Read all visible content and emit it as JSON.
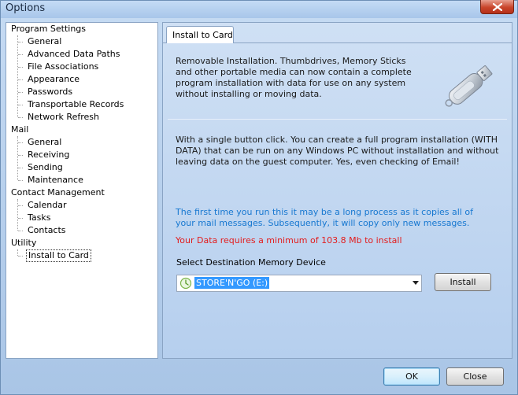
{
  "window": {
    "title": "Options"
  },
  "nav": {
    "categories": [
      {
        "label": "Program Settings",
        "items": [
          "General",
          "Advanced Data Paths",
          "File Associations",
          "Appearance",
          "Passwords",
          "Transportable Records",
          "Network Refresh"
        ]
      },
      {
        "label": "Mail",
        "items": [
          "General",
          "Receiving",
          "Sending",
          "Maintenance"
        ]
      },
      {
        "label": "Contact Management",
        "items": [
          "Calendar",
          "Tasks",
          "Contacts"
        ]
      },
      {
        "label": "Utility",
        "items": [
          "Install to Card"
        ]
      }
    ],
    "selected": "Install to Card"
  },
  "content": {
    "tab_label": "Install to Card",
    "intro": "Removable Installation.  Thumbdrives, Memory Sticks and other portable media can now contain a complete program installation with data for use on any system without installing or moving data.",
    "description": "With a single button click.  You can create a full program installation (WITH DATA) that can be run on any Windows PC without installation and without leaving data on the guest computer.  Yes, even checking of Email!",
    "first_time_note": "The first time you run this it may be a long process as it copies all of your mail messages.  Subsequently, it will copy only new messages.",
    "requirement_warning": "Your Data requires a minimum of 103.8 Mb to install",
    "select_label": "Select Destination Memory Device",
    "selected_device": "STORE'N'GO (E:)",
    "install_label": "Install"
  },
  "footer": {
    "ok_label": "OK",
    "close_label": "Close"
  },
  "colors": {
    "info_text": "#1778d0",
    "warning_text": "#e31c1c",
    "selection": "#3399ff"
  }
}
